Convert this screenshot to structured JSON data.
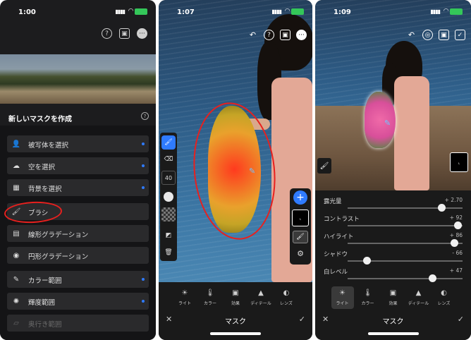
{
  "screen1": {
    "status_time": "1:00",
    "title": "新しいマスクを作成",
    "items": [
      {
        "label": "被写体を選択",
        "icon": "person-icon",
        "dot": true
      },
      {
        "label": "空を選択",
        "icon": "sky-icon",
        "dot": true
      },
      {
        "label": "背景を選択",
        "icon": "background-icon",
        "dot": true
      },
      {
        "label": "ブラシ",
        "icon": "brush-icon",
        "dot": false
      },
      {
        "label": "線形グラデーション",
        "icon": "linear-gradient-icon",
        "dot": false
      },
      {
        "label": "円形グラデーション",
        "icon": "radial-gradient-icon",
        "dot": false
      },
      {
        "label": "カラー範囲",
        "icon": "color-range-icon",
        "dot": true
      },
      {
        "label": "輝度範囲",
        "icon": "luminance-range-icon",
        "dot": true
      },
      {
        "label": "奥行き範囲",
        "icon": "depth-range-icon",
        "dot": false
      }
    ]
  },
  "screen2": {
    "status_time": "1:07",
    "brush_size": "40",
    "mask_label": "マスク",
    "tabs": [
      {
        "label": "ライト",
        "icon": "sun-icon"
      },
      {
        "label": "カラー",
        "icon": "thermometer-icon"
      },
      {
        "label": "効果",
        "icon": "effects-icon"
      },
      {
        "label": "ディテール",
        "icon": "triangle-icon"
      },
      {
        "label": "レンズ",
        "icon": "lens-icon"
      }
    ]
  },
  "screen3": {
    "status_time": "1:09",
    "mask_label": "マスク",
    "sliders": [
      {
        "label": "露光量",
        "value": "+ 2.70",
        "position": 0.82
      },
      {
        "label": "コントラスト",
        "value": "+ 92",
        "position": 0.96
      },
      {
        "label": "ハイライト",
        "value": "+ 86",
        "position": 0.93
      },
      {
        "label": "シャドウ",
        "value": "- 66",
        "position": 0.17
      },
      {
        "label": "白レベル",
        "value": "+ 47",
        "position": 0.74
      }
    ],
    "tabs": [
      {
        "label": "ライト",
        "icon": "sun-icon"
      },
      {
        "label": "カラー",
        "icon": "thermometer-icon"
      },
      {
        "label": "効果",
        "icon": "effects-icon"
      },
      {
        "label": "ディテール",
        "icon": "triangle-icon"
      },
      {
        "label": "レンズ",
        "icon": "lens-icon"
      }
    ],
    "selected_tab": 0
  },
  "colors": {
    "accent": "#2f7bff",
    "annotation": "#e8201e",
    "battery": "#34c759"
  }
}
